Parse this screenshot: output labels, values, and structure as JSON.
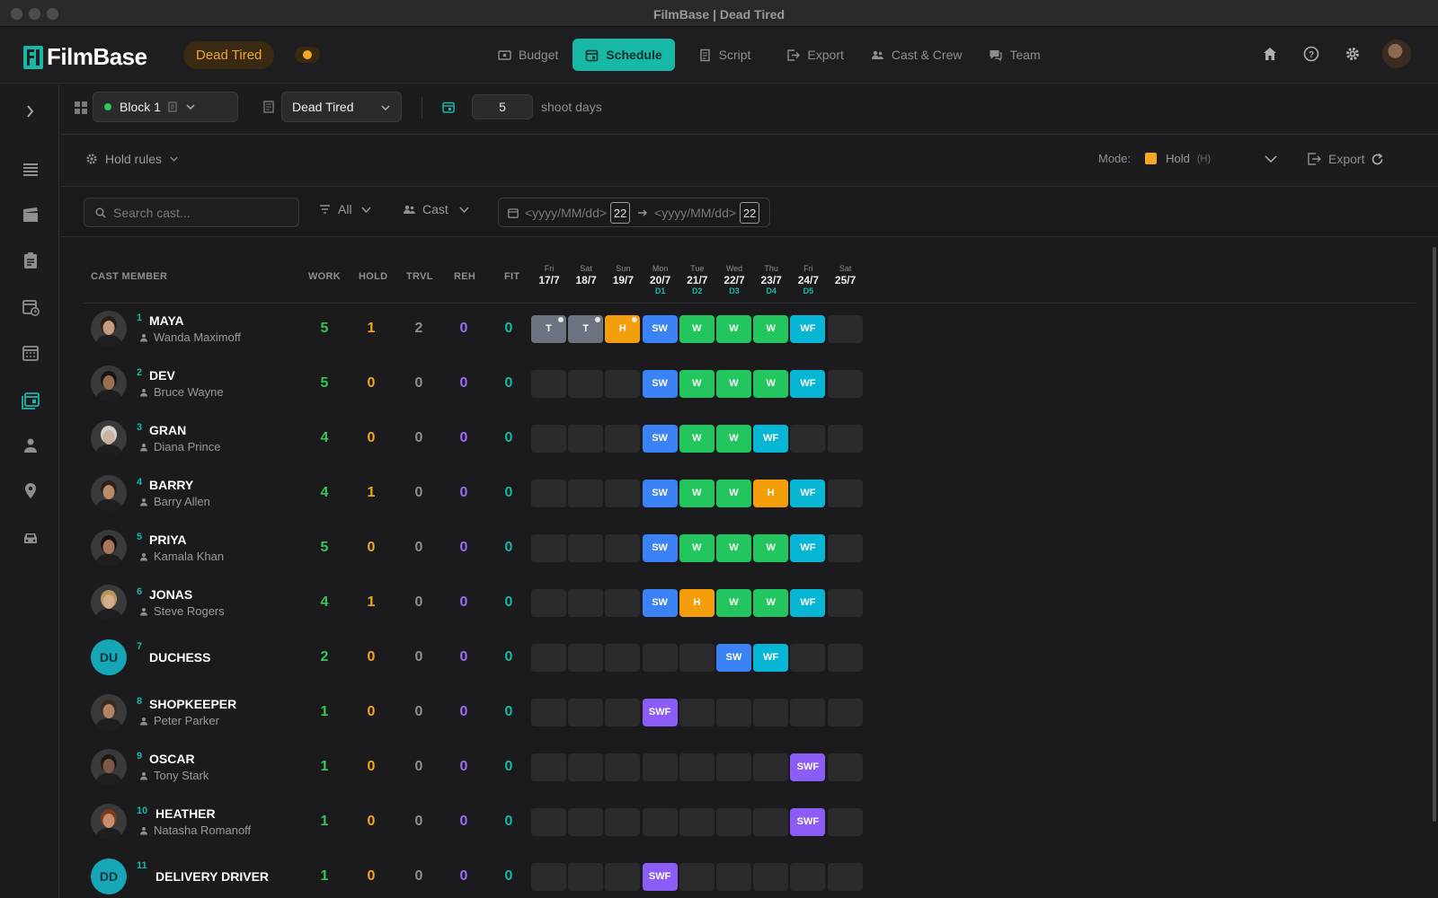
{
  "window": {
    "title": "FilmBase | Dead Tired"
  },
  "app": {
    "name": "FilmBase"
  },
  "project": {
    "name": "Dead Tired"
  },
  "colors": {
    "accent": "#17b8a6",
    "work": "#34c759",
    "hold": "#f5a623",
    "reh": "#9b6cf5",
    "cell_T": "#6b7280",
    "cell_H": "#f59e0b",
    "cell_SW": "#3b82f6",
    "cell_W": "#22c55e",
    "cell_WF": "#06b6d4",
    "cell_SWF": "#8b5cf6"
  },
  "nav": {
    "tabs": [
      {
        "label": "Budget",
        "icon": "money-icon",
        "active": false
      },
      {
        "label": "Schedule",
        "icon": "calendar-icon",
        "active": true
      },
      {
        "label": "Script",
        "icon": "script-icon",
        "active": false
      },
      {
        "label": "Export",
        "icon": "export-icon",
        "active": false
      },
      {
        "label": "Cast & Crew",
        "icon": "people-icon",
        "active": false
      },
      {
        "label": "Team",
        "icon": "chat-icon",
        "active": false
      }
    ],
    "right_icons": [
      "home-icon",
      "help-icon",
      "gear-icon",
      "user-avatar"
    ]
  },
  "sidebar": {
    "icons": [
      "expand-chevron-icon",
      "stripboard-icon",
      "clapperboard-icon",
      "clipboard-icon",
      "calendar-clock-icon",
      "calendar-icon",
      "cast-schedule-icon",
      "person-icon",
      "location-pin-icon",
      "car-icon"
    ],
    "active_index": 6
  },
  "toolbar": {
    "block": "Block 1",
    "script": "Dead Tired",
    "shoot_days_value": "5",
    "shoot_days_label": "shoot days"
  },
  "toolbar2": {
    "hold_rules": "Hold rules",
    "mode_label": "Mode:",
    "mode_value": "Hold",
    "mode_key": "(H)",
    "export": "Export"
  },
  "filters": {
    "search_placeholder": "Search cast...",
    "all": "All",
    "cast": "Cast",
    "date_from_placeholder": "<yyyy/MM/dd>",
    "date_to_placeholder": "<yyyy/MM/dd>",
    "calendar_day": "22"
  },
  "table": {
    "headers": {
      "cast_member": "CAST MEMBER",
      "work": "WORK",
      "hold": "HOLD",
      "trvl": "TRVL",
      "reh": "REH",
      "fit": "FIT"
    },
    "days": [
      {
        "dow": "Fri",
        "date": "17/7",
        "day": ""
      },
      {
        "dow": "Sat",
        "date": "18/7",
        "day": ""
      },
      {
        "dow": "Sun",
        "date": "19/7",
        "day": ""
      },
      {
        "dow": "Mon",
        "date": "20/7",
        "day": "D1"
      },
      {
        "dow": "Tue",
        "date": "21/7",
        "day": "D2"
      },
      {
        "dow": "Wed",
        "date": "22/7",
        "day": "D3"
      },
      {
        "dow": "Thu",
        "date": "23/7",
        "day": "D4"
      },
      {
        "dow": "Fri",
        "date": "24/7",
        "day": "D5"
      },
      {
        "dow": "Sat",
        "date": "25/7",
        "day": ""
      }
    ],
    "rows": [
      {
        "num": "1",
        "name": "MAYA",
        "actor": "Wanda Maximoff",
        "work": "5",
        "hold": "1",
        "trvl": "2",
        "reh": "0",
        "fit": "0",
        "avatar": "photo",
        "cells": [
          "T*",
          "T*",
          "H*",
          "SW",
          "W",
          "W",
          "W",
          "WF",
          ""
        ]
      },
      {
        "num": "2",
        "name": "DEV",
        "actor": "Bruce Wayne",
        "work": "5",
        "hold": "0",
        "trvl": "0",
        "reh": "0",
        "fit": "0",
        "avatar": "photo",
        "cells": [
          "",
          "",
          "",
          "SW",
          "W",
          "W",
          "W",
          "WF",
          ""
        ]
      },
      {
        "num": "3",
        "name": "GRAN",
        "actor": "Diana Prince",
        "work": "4",
        "hold": "0",
        "trvl": "0",
        "reh": "0",
        "fit": "0",
        "avatar": "photo",
        "cells": [
          "",
          "",
          "",
          "SW",
          "W",
          "W",
          "WF",
          "",
          ""
        ]
      },
      {
        "num": "4",
        "name": "BARRY",
        "actor": "Barry Allen",
        "work": "4",
        "hold": "1",
        "trvl": "0",
        "reh": "0",
        "fit": "0",
        "avatar": "photo",
        "cells": [
          "",
          "",
          "",
          "SW",
          "W",
          "W",
          "H",
          "WF",
          ""
        ]
      },
      {
        "num": "5",
        "name": "PRIYA",
        "actor": "Kamala Khan",
        "work": "5",
        "hold": "0",
        "trvl": "0",
        "reh": "0",
        "fit": "0",
        "avatar": "photo",
        "cells": [
          "",
          "",
          "",
          "SW",
          "W",
          "W",
          "W",
          "WF",
          ""
        ]
      },
      {
        "num": "6",
        "name": "JONAS",
        "actor": "Steve Rogers",
        "work": "4",
        "hold": "1",
        "trvl": "0",
        "reh": "0",
        "fit": "0",
        "avatar": "photo",
        "cells": [
          "",
          "",
          "",
          "SW",
          "H",
          "W",
          "W",
          "WF",
          ""
        ]
      },
      {
        "num": "7",
        "name": "DUCHESS",
        "actor": "",
        "work": "2",
        "hold": "0",
        "trvl": "0",
        "reh": "0",
        "fit": "0",
        "avatar": "DU",
        "cells": [
          "",
          "",
          "",
          "",
          "",
          "SW",
          "WF",
          "",
          ""
        ]
      },
      {
        "num": "8",
        "name": "SHOPKEEPER",
        "actor": "Peter Parker",
        "work": "1",
        "hold": "0",
        "trvl": "0",
        "reh": "0",
        "fit": "0",
        "avatar": "photo",
        "cells": [
          "",
          "",
          "",
          "SWF",
          "",
          "",
          "",
          "",
          ""
        ]
      },
      {
        "num": "9",
        "name": "OSCAR",
        "actor": "Tony Stark",
        "work": "1",
        "hold": "0",
        "trvl": "0",
        "reh": "0",
        "fit": "0",
        "avatar": "photo",
        "cells": [
          "",
          "",
          "",
          "",
          "",
          "",
          "",
          "SWF",
          ""
        ]
      },
      {
        "num": "10",
        "name": "HEATHER",
        "actor": "Natasha Romanoff",
        "work": "1",
        "hold": "0",
        "trvl": "0",
        "reh": "0",
        "fit": "0",
        "avatar": "photo",
        "cells": [
          "",
          "",
          "",
          "",
          "",
          "",
          "",
          "SWF",
          ""
        ]
      },
      {
        "num": "11",
        "name": "DELIVERY DRIVER",
        "actor": "",
        "work": "1",
        "hold": "0",
        "trvl": "0",
        "reh": "0",
        "fit": "0",
        "avatar": "DD",
        "cells": [
          "",
          "",
          "",
          "SWF",
          "",
          "",
          "",
          "",
          ""
        ]
      }
    ]
  }
}
